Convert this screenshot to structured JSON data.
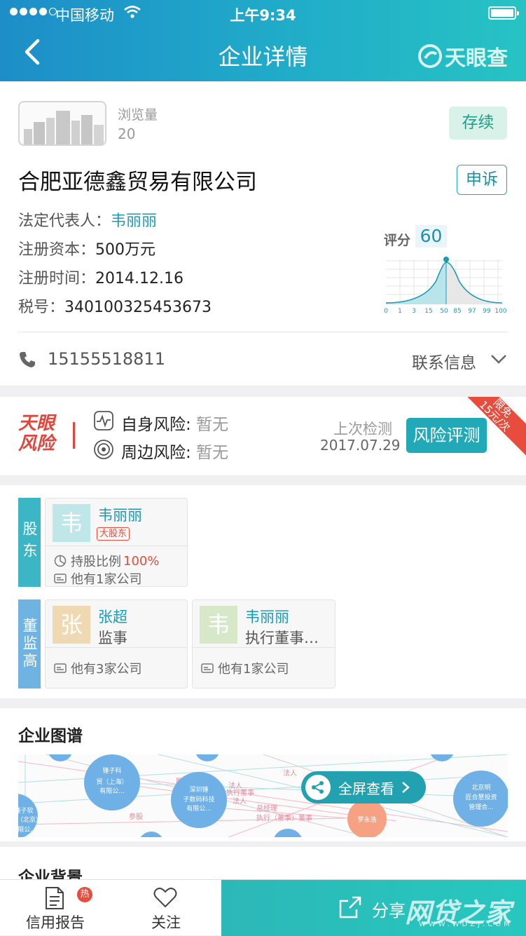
{
  "status_bar": {
    "carrier": "中国移动",
    "time": "上午9:34"
  },
  "nav": {
    "title": "企业详情",
    "logo_text": "天眼查"
  },
  "company": {
    "views_label": "浏览量",
    "views_value": "20",
    "status": "存续",
    "appeal": "申诉",
    "name": "合肥亚德鑫贸易有限公司",
    "legal_label": "法定代表人：",
    "legal_value": "韦丽丽",
    "capital_label": "注册资本：",
    "capital_value": "500万元",
    "reg_time_label": "注册时间：",
    "reg_time_value": "2014.12.16",
    "tax_label": "税号：",
    "tax_value": "340100325453673",
    "score_label": "评分",
    "score_value": "60",
    "score_ticks": [
      "0",
      "1",
      "3",
      "15",
      "50",
      "85",
      "97",
      "99",
      "100"
    ],
    "phone": "15155518811",
    "contact_label": "联系信息"
  },
  "risk": {
    "logo_line1": "天眼",
    "logo_line2": "风险",
    "self_label": "自身风险:",
    "self_value": "暂无",
    "around_label": "周边风险:",
    "around_value": "暂无",
    "last_check_label": "上次检测",
    "last_check_date": "2017.07.29",
    "button": "风险评测",
    "ribbon_line1": "限免",
    "ribbon_line2": "15元/次"
  },
  "people": {
    "shareholder_tag": "股东",
    "director_tag": "董监高",
    "shareholders": [
      {
        "avatar": "韦",
        "name": "韦丽丽",
        "badge": "大股东",
        "ratio_label": "持股比例",
        "ratio_value": "100%",
        "other": "他有1家公司",
        "avatar_color": "#bfe6e8"
      }
    ],
    "directors": [
      {
        "avatar": "张",
        "name": "张超",
        "role": "监事",
        "other": "他有3家公司",
        "avatar_color": "#efd9b3"
      },
      {
        "avatar": "韦",
        "name": "韦丽丽",
        "role": "执行董事…",
        "other": "他有1家公司",
        "avatar_color": "#d6e8c8"
      }
    ]
  },
  "graph": {
    "title": "企业图谱",
    "fullscreen": "全屏查看",
    "nodes": [
      "锤子科技（上海）有限公...",
      "深圳锤子数码科技有限公...",
      "北京明匠合慧投资管理合...",
      "锤子软件（北京）有限公...",
      "罗永浩"
    ],
    "edge_labels": [
      "法人",
      "执行董事",
      "总经理",
      "股东",
      "参股",
      "执行（董事）董事",
      "法人",
      "法人"
    ]
  },
  "background": {
    "title": "企业背景"
  },
  "tabbar": {
    "report": "信用报告",
    "hot": "热",
    "follow": "关注",
    "share": "分享",
    "watermark": "网贷之家",
    "watermark_url": "WWW.WDZJ.COM"
  }
}
